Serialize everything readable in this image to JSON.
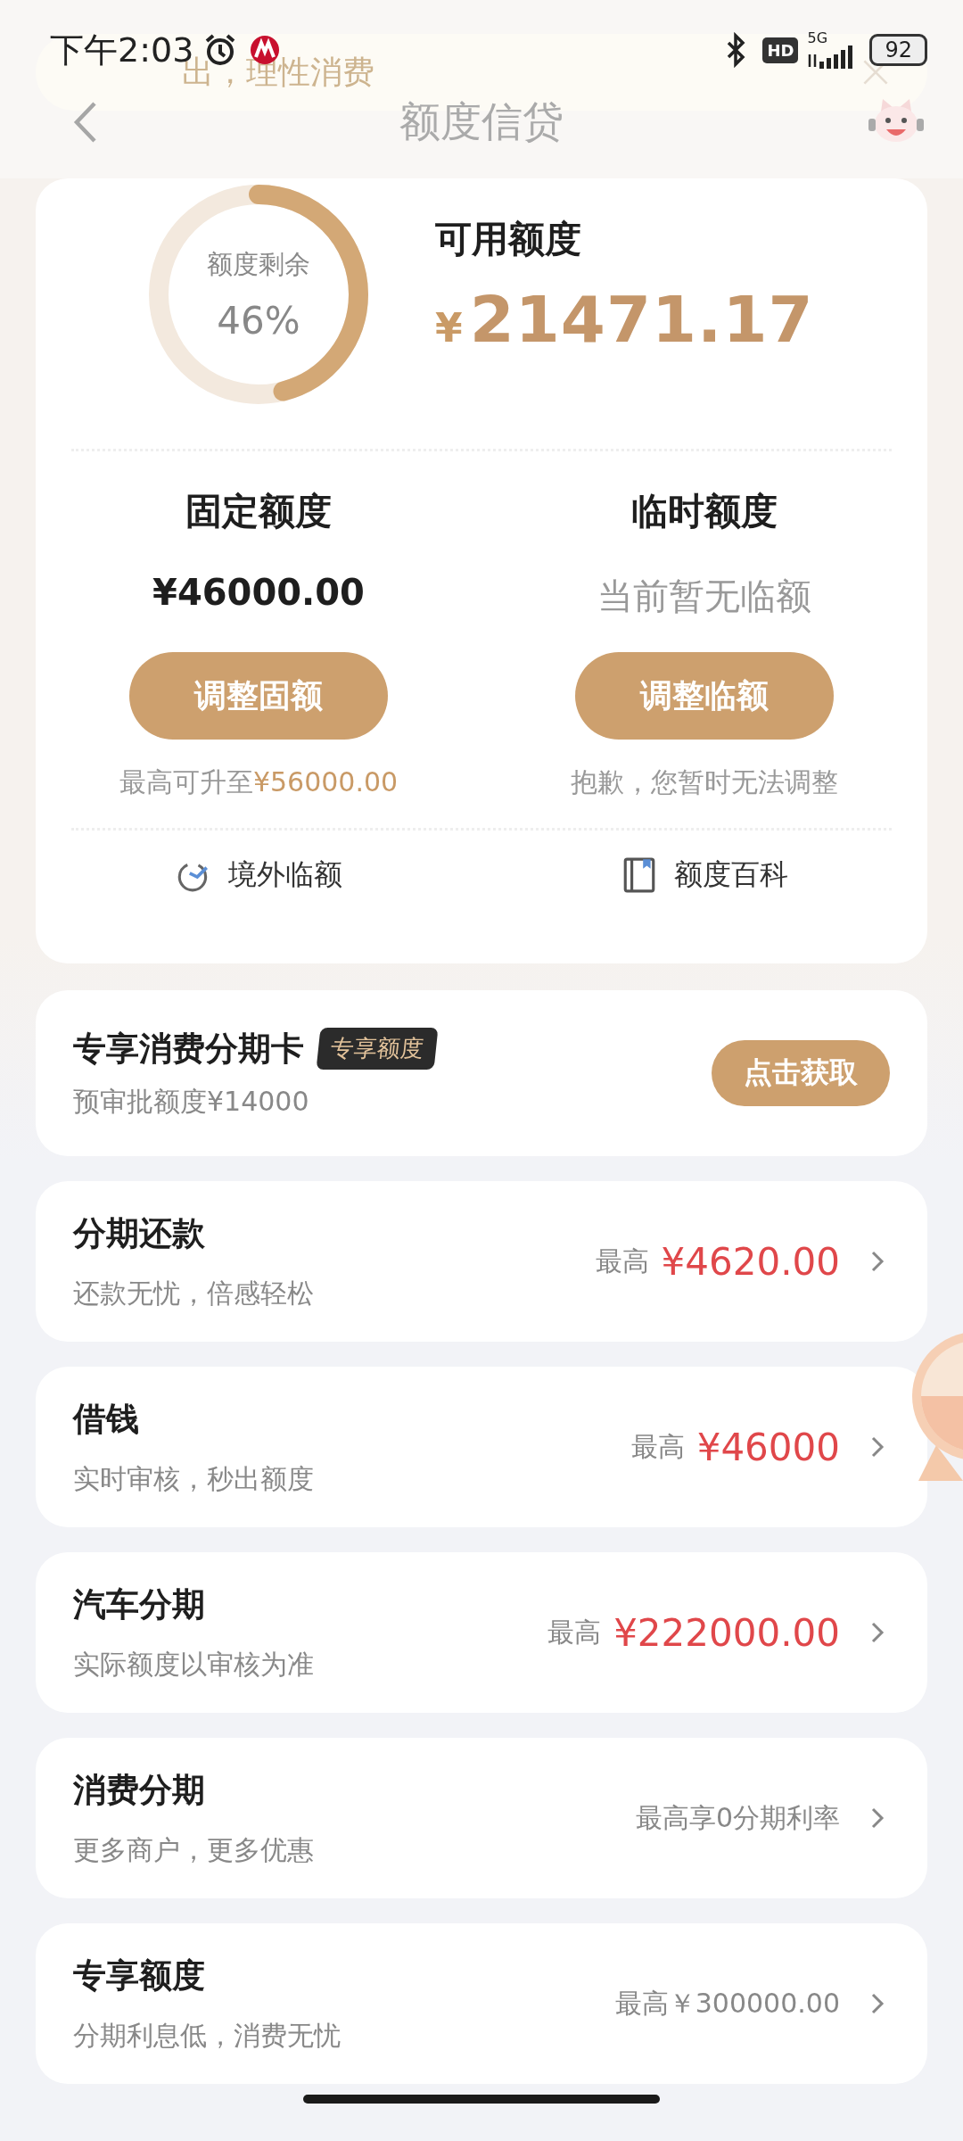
{
  "status_bar": {
    "time": "下午2:03",
    "hd": "HD",
    "network": "5G",
    "battery": "92"
  },
  "notice": {
    "text": "出，理性消费"
  },
  "header": {
    "title": "额度信贷"
  },
  "summary": {
    "ring_label": "额度剩余",
    "ring_percent": "46%",
    "level": 0.46,
    "available_label": "可用额度",
    "currency": "¥",
    "available_amount": "21471.17"
  },
  "limits": [
    {
      "title": "固定额度",
      "value": "¥46000.00",
      "kind": "amount",
      "button": "调整固额",
      "note": "最高可升至**¥56000.00**"
    },
    {
      "title": "临时额度",
      "value": "当前暂无临额",
      "kind": "empty",
      "button": "调整临额",
      "note": "抱歉，您暂时无法调整"
    }
  ],
  "links": [
    {
      "label": "境外临额",
      "kind": "plane"
    },
    {
      "label": "额度百科",
      "kind": "book"
    }
  ],
  "promo": {
    "title": "专享消费分期卡",
    "tag": "专享额度",
    "subtitle": "预审批额度¥14000",
    "button": "点击获取"
  },
  "products": [
    {
      "title": "分期还款",
      "subtitle": "还款无忧，倍感轻松",
      "kind": "amount",
      "prefix": "最高",
      "value": "¥4620.00"
    },
    {
      "title": "借钱",
      "subtitle": "实时审核，秒出额度",
      "kind": "amount",
      "prefix": "最高",
      "value": "¥46000"
    },
    {
      "title": "汽车分期",
      "subtitle": "实际额度以审核为准",
      "kind": "amount",
      "prefix": "最高",
      "value": "¥222000.00"
    },
    {
      "title": "消费分期",
      "subtitle": "更多商户，更多优惠",
      "kind": "text",
      "value": "最高享0分期利率"
    },
    {
      "title": "专享额度",
      "subtitle": "分期利息低，消费无忧",
      "kind": "text",
      "value": "最高￥300000.00"
    }
  ]
}
